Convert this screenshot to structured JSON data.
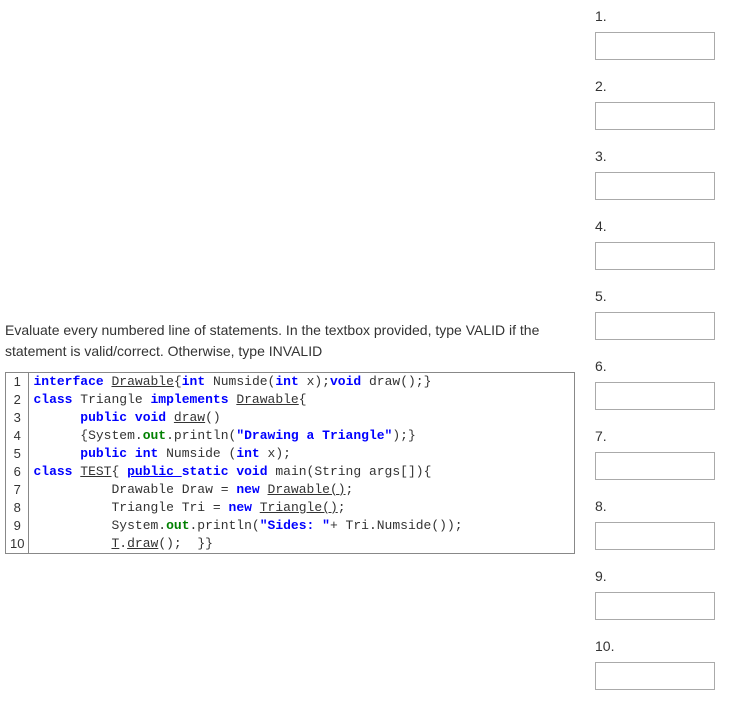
{
  "instructions": "Evaluate every numbered line of statements.  In the textbox provided, type VALID if the statement is valid/correct.  Otherwise, type INVALID",
  "lineNumbers": [
    "1",
    "2",
    "3",
    "4",
    "5",
    "6",
    "7",
    "8",
    "9",
    "10"
  ],
  "code": {
    "l1": {
      "t1": "interface ",
      "t2": "Drawable",
      "t3": "{",
      "t4": "int ",
      "t5": "Numside(",
      "t6": "int ",
      "t7": "x);",
      "t8": "void ",
      "t9": "draw();}"
    },
    "l2": {
      "t1": "class ",
      "t2": "Triangle ",
      "t3": "implements ",
      "t4": "Drawable",
      "t5": "{"
    },
    "l3": {
      "pad": "      ",
      "t1": "public void ",
      "t2": "draw",
      "t3": "()"
    },
    "l4": {
      "pad": "      ",
      "t1": "{System.",
      "t2": "out",
      "t3": ".println(",
      "t4": "\"Drawing a Triangle\"",
      "t5": ");}"
    },
    "l5": {
      "pad": "      ",
      "t1": "public int ",
      "t2": "Numside (",
      "t3": "int ",
      "t4": "x);"
    },
    "l6": {
      "t1": "class ",
      "t2": "TEST",
      "t3": "{ ",
      "t4": "public ",
      "t5": "static void ",
      "t6": "main(String args[]){"
    },
    "l7": {
      "pad": "          ",
      "t1": "Drawable Draw = ",
      "t2": "new ",
      "t3": "Drawable()",
      "t4": ";"
    },
    "l8": {
      "pad": "          ",
      "t1": "Triangle Tri = ",
      "t2": "new ",
      "t3": "Triangle()",
      "t4": ";"
    },
    "l9": {
      "pad": "          ",
      "t1": "System.",
      "t2": "out",
      "t3": ".println(",
      "t4": "\"Sides: \"",
      "t5": "+ Tri.Numside());"
    },
    "l10": {
      "pad": "          ",
      "t1": "T",
      "t2": ".",
      "t3": "draw",
      "t4": "();  }}"
    }
  },
  "answers": [
    {
      "label": "1.",
      "value": ""
    },
    {
      "label": "2.",
      "value": ""
    },
    {
      "label": "3.",
      "value": ""
    },
    {
      "label": "4.",
      "value": ""
    },
    {
      "label": "5.",
      "value": ""
    },
    {
      "label": "6.",
      "value": ""
    },
    {
      "label": "7.",
      "value": ""
    },
    {
      "label": "8.",
      "value": ""
    },
    {
      "label": "9.",
      "value": ""
    },
    {
      "label": "10.",
      "value": ""
    }
  ]
}
